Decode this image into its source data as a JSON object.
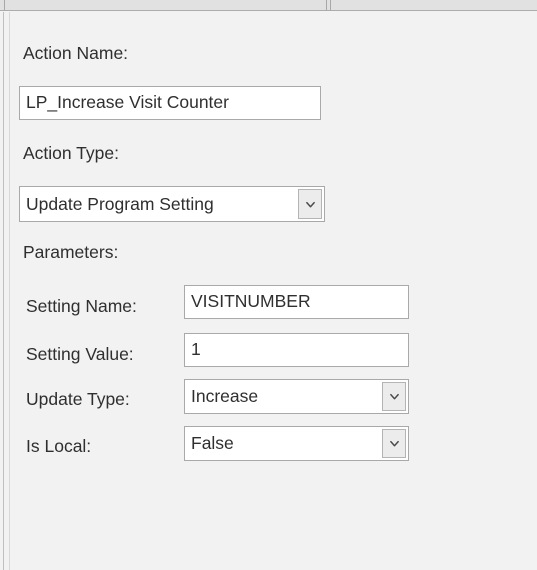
{
  "window": {
    "background_color": "#f2f2f2",
    "text_color": "#2f2f2f",
    "field_border_color": "#a9a9a9"
  },
  "tabstrip": {
    "background_color": "#e1e1e1",
    "border_color": "#acacac"
  },
  "form": {
    "action_name": {
      "label": "Action Name:",
      "value": "LP_Increase Visit Counter",
      "placeholder": ""
    },
    "action_type": {
      "label": "Action Type:",
      "value": "Update Program Setting",
      "dropdown_icon": "chevron-down-icon"
    },
    "parameters": {
      "label": "Parameters:",
      "rows": [
        {
          "label": "Setting Name:",
          "value": "VISITNUMBER",
          "kind": "text",
          "placeholder": ""
        },
        {
          "label": "Setting Value:",
          "value": "1",
          "kind": "text",
          "placeholder": ""
        },
        {
          "label": "Update Type:",
          "value": "Increase",
          "kind": "combo",
          "dropdown_icon": "chevron-down-icon"
        },
        {
          "label": "Is Local:",
          "value": "False",
          "kind": "combo",
          "dropdown_icon": "chevron-down-icon"
        }
      ]
    }
  }
}
